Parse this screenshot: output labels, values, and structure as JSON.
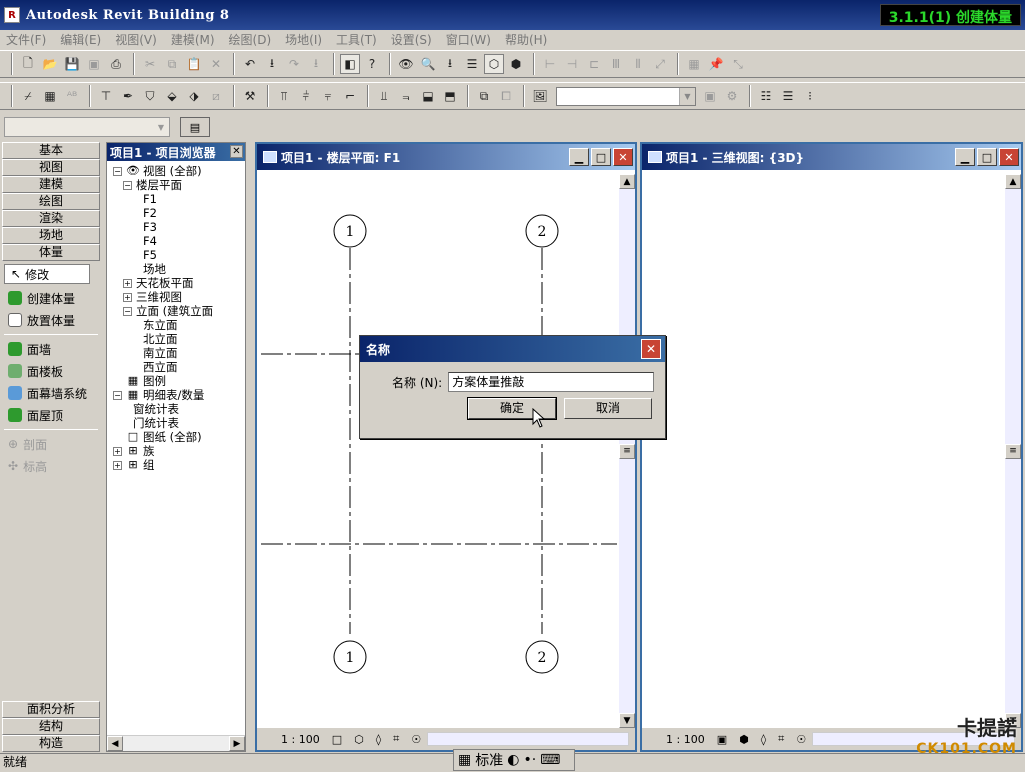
{
  "window": {
    "title": "Autodesk Revit Building 8",
    "lesson_badge": "3.1.1(1) 创建体量"
  },
  "menu": [
    "文件(F)",
    "编辑(E)",
    "视图(V)",
    "建模(M)",
    "绘图(D)",
    "场地(I)",
    "工具(T)",
    "设置(S)",
    "窗口(W)",
    "帮助(H)"
  ],
  "design_bar": {
    "top_tabs": [
      "基本",
      "视图",
      "建模",
      "绘图",
      "渲染",
      "场地",
      "体量"
    ],
    "modify": "修改",
    "tools": [
      "创建体量",
      "放置体量",
      "面墙",
      "面楼板",
      "面幕墙系统",
      "面屋顶"
    ],
    "disabled_tools": [
      "剖面",
      "标高"
    ],
    "bottom_tabs": [
      "面积分析",
      "结构",
      "构造"
    ]
  },
  "project_browser": {
    "title": "项目1 - 项目浏览器",
    "tree": [
      {
        "label": "视图 (全部)",
        "expander": "−",
        "icon": "👁",
        "indent": 0
      },
      {
        "label": "楼层平面",
        "expander": "−",
        "indent": 1
      },
      {
        "label": "F1",
        "indent": 3
      },
      {
        "label": "F2",
        "indent": 3
      },
      {
        "label": "F3",
        "indent": 3
      },
      {
        "label": "F4",
        "indent": 3
      },
      {
        "label": "F5",
        "indent": 3
      },
      {
        "label": "场地",
        "indent": 3
      },
      {
        "label": "天花板平面",
        "expander": "+",
        "indent": 1
      },
      {
        "label": "三维视图",
        "expander": "+",
        "indent": 1
      },
      {
        "label": "立面 (建筑立面",
        "expander": "−",
        "indent": 1
      },
      {
        "label": "东立面",
        "indent": 3
      },
      {
        "label": "北立面",
        "indent": 3
      },
      {
        "label": "南立面",
        "indent": 3
      },
      {
        "label": "西立面",
        "indent": 3
      },
      {
        "label": "图例",
        "icon": "▦",
        "indent": 0
      },
      {
        "label": "明细表/数量",
        "expander": "−",
        "icon": "▦",
        "indent": 0
      },
      {
        "label": "窗统计表",
        "indent": 2
      },
      {
        "label": "门统计表",
        "indent": 2
      },
      {
        "label": "图纸 (全部)",
        "icon": "□",
        "indent": 0
      },
      {
        "label": "族",
        "expander": "+",
        "icon": "⊞",
        "indent": 0
      },
      {
        "label": "组",
        "expander": "+",
        "icon": "⊞",
        "indent": 0
      }
    ]
  },
  "view1": {
    "title": "项目1 - 楼层平面: F1",
    "scale": "1 : 100",
    "grid_labels": [
      "1",
      "2"
    ]
  },
  "view2": {
    "title": "项目1 - 三维视图: {3D}",
    "scale": "1 : 100"
  },
  "dialog": {
    "title": "名称",
    "label": "名称 (N):",
    "value": "方案体量推敲",
    "ok": "确定",
    "cancel": "取消"
  },
  "status": {
    "text": "就绪",
    "ime": "标准"
  },
  "watermark": {
    "line1": "卡提諾",
    "line2": "CK101.COM"
  }
}
